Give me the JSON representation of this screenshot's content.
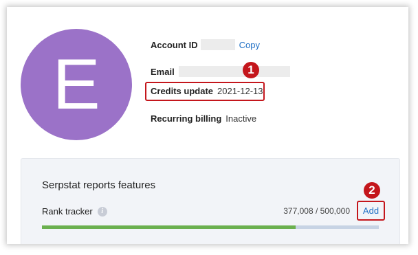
{
  "avatar": {
    "letter": "E",
    "color": "#9b72c8"
  },
  "account": {
    "id_label": "Account ID",
    "copy_label": "Copy",
    "email_label": "Email",
    "credits_label": "Credits update",
    "credits_value": "2021-12-13",
    "billing_label": "Recurring billing",
    "billing_value": "Inactive"
  },
  "annotations": {
    "marker1": "1",
    "marker2": "2",
    "highlight_color": "#c4161c"
  },
  "features": {
    "title": "Serpstat reports features",
    "rank_tracker": {
      "label": "Rank tracker",
      "info_icon": "info-icon",
      "usage_text": "377,008 / 500,000",
      "used": 377008,
      "limit": 500000,
      "add_label": "Add"
    }
  },
  "colors": {
    "link": "#1f6fc5",
    "progress_fill": "#6bb04f",
    "progress_track": "#c7d3e4"
  }
}
